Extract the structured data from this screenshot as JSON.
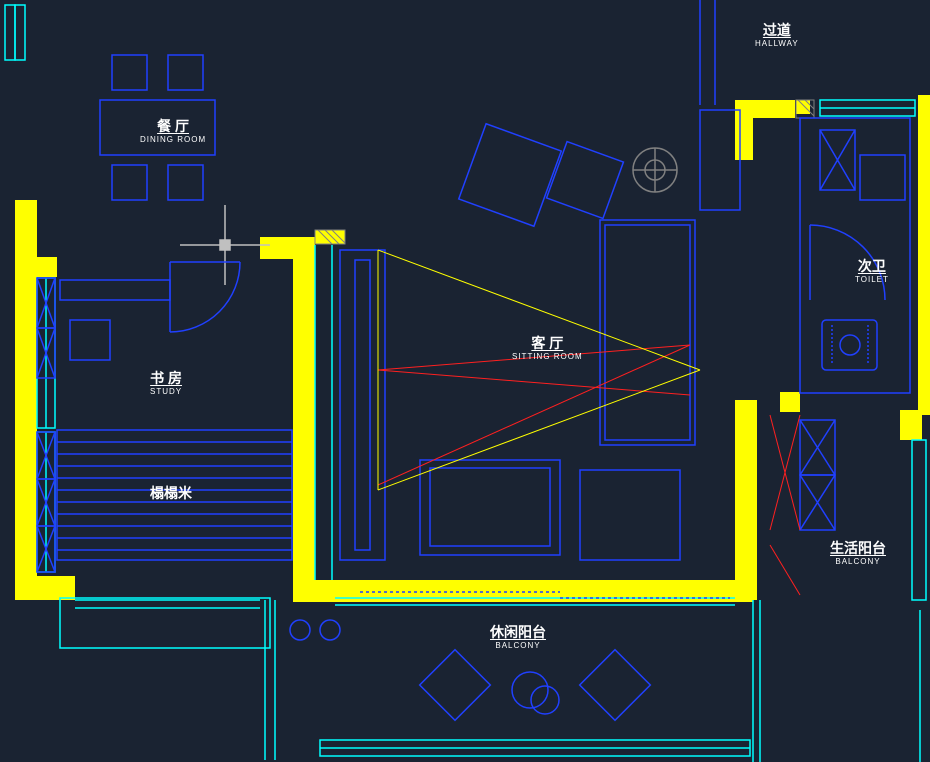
{
  "drawing": {
    "type": "floor_plan",
    "software_style": "AutoCAD",
    "background": "#1a2332",
    "layers": {
      "walls": "#ffff00",
      "furniture": "#0000ff",
      "windows": "#00ffff",
      "doors": "#0000ff",
      "annotation_red": "#ff0000",
      "text": "#ffffff"
    }
  },
  "rooms": {
    "hallway": {
      "cn": "过道",
      "en": "HALLWAY"
    },
    "dining": {
      "cn": "餐 厅",
      "en": "DINING ROOM"
    },
    "study": {
      "cn": "书 房",
      "en": "STUDY"
    },
    "tatami": {
      "cn": "榻榻米",
      "en": ""
    },
    "sitting": {
      "cn": "客 厅",
      "en": "SITTING ROOM"
    },
    "toilet": {
      "cn": "次卫",
      "en": "TOILET"
    },
    "balcony_life": {
      "cn": "生活阳台",
      "en": "BALCONY"
    },
    "balcony_leisure": {
      "cn": "休闲阳台",
      "en": "BALCONY"
    }
  }
}
